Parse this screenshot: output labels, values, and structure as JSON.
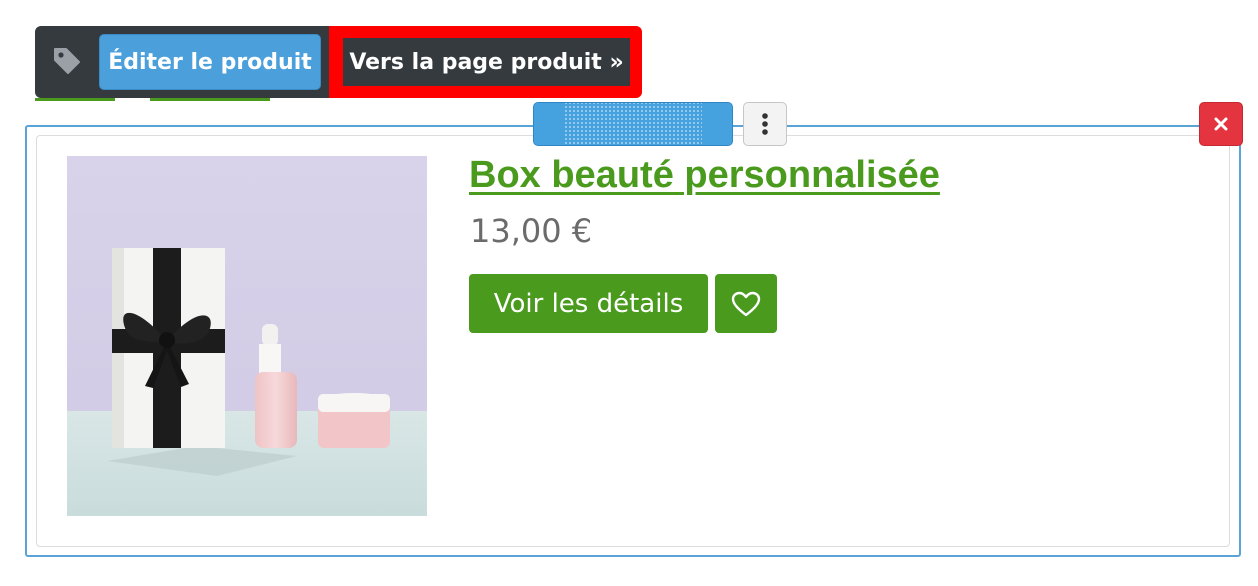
{
  "toolbar": {
    "tag_icon": "tag-icon",
    "edit_label": "Éditer le produit",
    "goto_label": "Vers la page produit »",
    "highlight_color": "#ff0000",
    "edit_color": "#4b9fdb",
    "dark_color": "#353a3f"
  },
  "widget": {
    "drag_handle_icon": "drag-handle",
    "menu_icon": "vertical-dots-icon",
    "close_icon": "close-icon",
    "frame_color": "#5aa3d6",
    "close_color": "#e3343f"
  },
  "product": {
    "image": "product-photo-gift-box-with-cosmetics",
    "title": "Box beauté personnalisée",
    "price": "13,00 €",
    "details_label": "Voir les détails",
    "wishlist_icon": "heart-icon",
    "accent_color": "#4a9a1e"
  }
}
